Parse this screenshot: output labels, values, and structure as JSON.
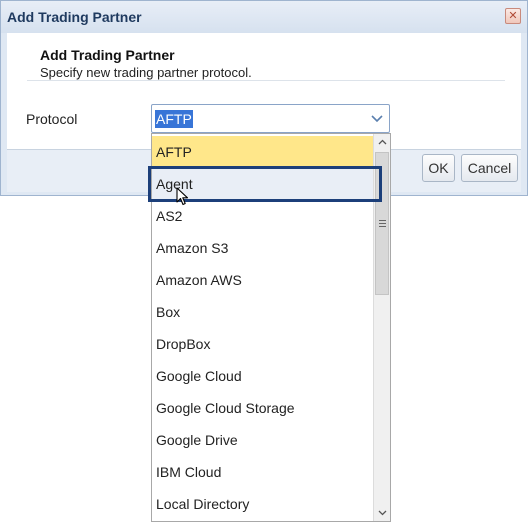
{
  "dialog": {
    "title": "Add Trading Partner",
    "header_title": "Add Trading Partner",
    "header_subtitle": "Specify new trading partner protocol.",
    "protocol_label": "Protocol",
    "ok_label": "OK",
    "cancel_label": "Cancel"
  },
  "combo": {
    "value": "AFTP"
  },
  "dropdown": {
    "options": [
      {
        "label": "AFTP",
        "state": "selected"
      },
      {
        "label": "Agent",
        "state": "hover"
      },
      {
        "label": "AS2",
        "state": ""
      },
      {
        "label": "Amazon S3",
        "state": ""
      },
      {
        "label": "Amazon AWS",
        "state": ""
      },
      {
        "label": "Box",
        "state": ""
      },
      {
        "label": "DropBox",
        "state": ""
      },
      {
        "label": "Google Cloud",
        "state": ""
      },
      {
        "label": "Google Cloud Storage",
        "state": ""
      },
      {
        "label": "Google Drive",
        "state": ""
      },
      {
        "label": "IBM Cloud",
        "state": ""
      },
      {
        "label": "Local Directory",
        "state": ""
      }
    ]
  },
  "icons": {
    "close": "close-icon",
    "combo_arrow": "chevron-down-icon",
    "scroll_up": "scroll-up-icon",
    "scroll_down": "scroll-down-icon",
    "cursor": "mouse-pointer-icon"
  },
  "colors": {
    "selected_bg": "#ffe78a",
    "hover_bg": "#e9eef6",
    "focus_border": "#1c3f7a",
    "text_highlight": "#3875d7"
  }
}
